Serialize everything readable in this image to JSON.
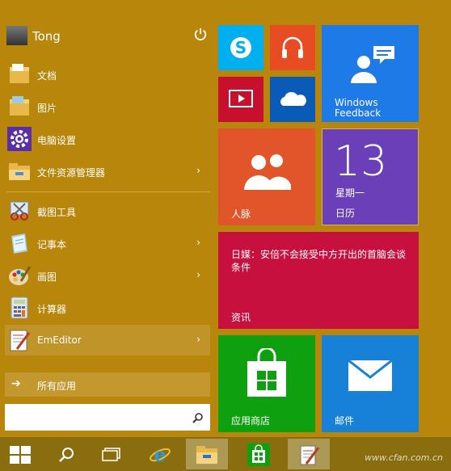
{
  "user": {
    "name": "Tong"
  },
  "menu": {
    "items": [
      {
        "label": "文档",
        "icon": "documents-folder-icon",
        "arrow": ""
      },
      {
        "label": "图片",
        "icon": "pictures-folder-icon",
        "arrow": ""
      },
      {
        "label": "电脑设置",
        "icon": "pc-settings-gear-icon",
        "arrow": ""
      },
      {
        "label": "文件资源管理器",
        "icon": "file-explorer-icon",
        "arrow": "›"
      },
      {
        "label": "截图工具",
        "icon": "snipping-tool-icon",
        "arrow": ""
      },
      {
        "label": "记事本",
        "icon": "notepad-icon",
        "arrow": "›"
      },
      {
        "label": "画图",
        "icon": "paint-icon",
        "arrow": "›"
      },
      {
        "label": "计算器",
        "icon": "calculator-icon",
        "arrow": ""
      },
      {
        "label": "EmEditor",
        "icon": "emeditor-icon",
        "arrow": "›"
      }
    ],
    "all_apps": "所有应用",
    "search_placeholder": ""
  },
  "tiles": {
    "feedback": "Windows Feedback",
    "feedback_line1": "Windows",
    "feedback_line2": "Feedback",
    "people": "人脉",
    "calendar_day": "13",
    "calendar_weekday": "星期一",
    "calendar": "日历",
    "news_headline": "日媒：安倍不会接受中方开出的首脑会谈条件",
    "news": "资讯",
    "store": "应用商店",
    "mail": "邮件"
  },
  "colors": {
    "background": "#b8860b",
    "skype": "#00aff0",
    "music": "#e84c22",
    "video": "#c8102e",
    "onedrive": "#0a5ab7",
    "feedback": "#1e7ae6",
    "people": "#e2552a",
    "calendar": "#6a3fb8",
    "news": "#c8103f",
    "store": "#0fa00f",
    "mail": "#1780d7",
    "taskbar": "#8a6d0e"
  },
  "taskbar": {
    "start": "start-button",
    "search": "search-icon",
    "taskview": "task-view-icon",
    "ie": "internet-explorer-icon",
    "explorer": "file-explorer-icon",
    "store": "store-icon",
    "notepad": "notepad-icon"
  },
  "watermark": "www.cfan.com.cn"
}
